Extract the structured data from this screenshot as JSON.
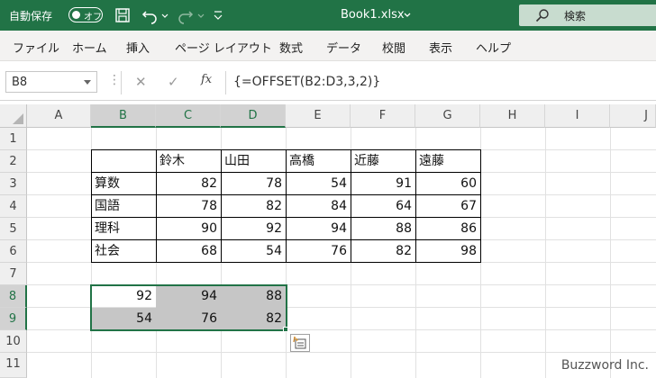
{
  "titlebar": {
    "autosave_label": "自動保存",
    "toggle_state": "オフ",
    "file_title": "Book1.xlsx",
    "search_placeholder": "検索",
    "icons": [
      "save-icon",
      "undo-icon",
      "redo-icon",
      "customize-qat-icon",
      "search-icon"
    ]
  },
  "menu": {
    "items": [
      "ファイル",
      "ホーム",
      "挿入",
      "ページ レイアウト",
      "数式",
      "データ",
      "校閲",
      "表示",
      "ヘルプ"
    ]
  },
  "formula_bar": {
    "name_box": "B8",
    "fx_label": "fx",
    "formula": "{=OFFSET(B2:D3,3,2)}"
  },
  "sheet": {
    "columns": [
      "A",
      "B",
      "C",
      "D",
      "E",
      "F",
      "G",
      "H",
      "I",
      "J"
    ],
    "rows": [
      "1",
      "2",
      "3",
      "4",
      "5",
      "6",
      "7",
      "8",
      "9",
      "10",
      "11"
    ],
    "selected_columns": [
      "B",
      "C",
      "D"
    ],
    "selected_rows": [
      "8",
      "9"
    ],
    "table": {
      "headers": [
        "",
        "鈴木",
        "山田",
        "高橋",
        "近藤",
        "遠藤"
      ],
      "rows": [
        {
          "label": "算数",
          "values": [
            "82",
            "78",
            "54",
            "91",
            "60"
          ]
        },
        {
          "label": "国語",
          "values": [
            "78",
            "82",
            "84",
            "64",
            "67"
          ]
        },
        {
          "label": "理科",
          "values": [
            "90",
            "92",
            "94",
            "88",
            "86"
          ]
        },
        {
          "label": "社会",
          "values": [
            "68",
            "54",
            "76",
            "82",
            "98"
          ]
        }
      ]
    },
    "result": {
      "row8": [
        "92",
        "94",
        "88"
      ],
      "row9": [
        "54",
        "76",
        "82"
      ]
    }
  },
  "watermark": "Buzzword Inc.",
  "colors": {
    "accent": "#217346",
    "selection_fill": "#c6c6c6"
  }
}
